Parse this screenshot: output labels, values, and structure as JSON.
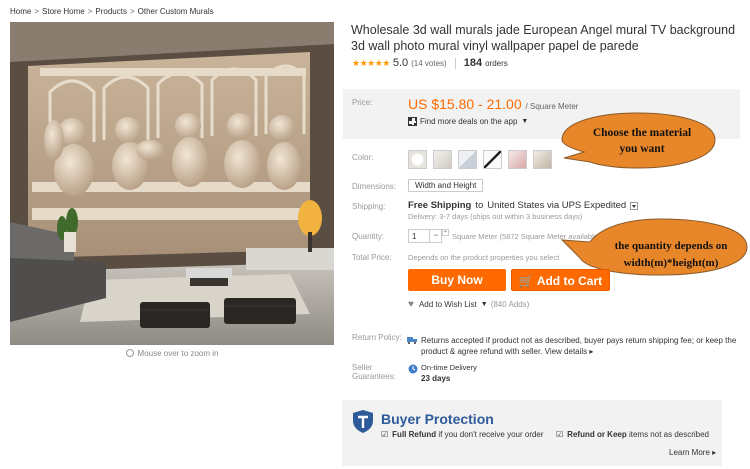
{
  "breadcrumb": {
    "items": [
      "Home",
      "Store Home",
      "Products",
      "Other Custom Murals"
    ],
    "separator": ">"
  },
  "image": {
    "zoom_hint": "Mouse over to zoom in"
  },
  "product": {
    "title": "Wholesale 3d wall murals jade European Angel mural TV background 3d wall photo mural vinyl wallpaper papel de parede",
    "stars": "★★★★★",
    "rating": "5.0",
    "votes": "(14 votes)",
    "orders_count": "184",
    "orders_label": "orders"
  },
  "price": {
    "label": "Price:",
    "value": "US $15.80 - 21.00",
    "unit": "/ Square Meter",
    "deals": "Find more deals on the app"
  },
  "color": {
    "label": "Color:"
  },
  "callouts": {
    "material": "Choose the material you want",
    "quantity": "the quantity depends on width(m)*height(m)"
  },
  "dimensions": {
    "label": "Dimensions:",
    "value": "Width and Height"
  },
  "shipping": {
    "label": "Shipping:",
    "method": "Free Shipping",
    "to": "to",
    "destination": "United States via UPS Expedited",
    "delivery": "Delivery: 3-7 days (ships out within 3 business days)"
  },
  "quantity": {
    "label": "Quantity:",
    "value": "1",
    "minus": "−",
    "plus": "+",
    "note": "Square Meter (5872 Square Meter available)"
  },
  "total": {
    "label": "Total Price:",
    "note": "Depends on the product properties you select"
  },
  "buttons": {
    "buy_now": "Buy Now",
    "add_to_cart": "Add to Cart"
  },
  "wishlist": {
    "label": "Add to Wish List",
    "count": "(840 Adds)"
  },
  "return_policy": {
    "label": "Return Policy:",
    "text": "Returns accepted if product not as described, buyer pays return shipping fee; or keep the product & agree refund with seller.",
    "link": "View details"
  },
  "seller": {
    "label": "Seller Guarantees:",
    "ontime": "On-time Delivery",
    "days": "23 days"
  },
  "buyer_protection": {
    "title": "Buyer Protection",
    "refund_bold": "Full Refund",
    "refund_text": "if you don't receive your order",
    "keep_bold": "Refund or Keep",
    "keep_text": "items not as described",
    "learn_more": "Learn More"
  },
  "colors": {
    "accent": "#ff6a00",
    "protection_blue": "#2d5a99",
    "callout": "#e8862a"
  }
}
